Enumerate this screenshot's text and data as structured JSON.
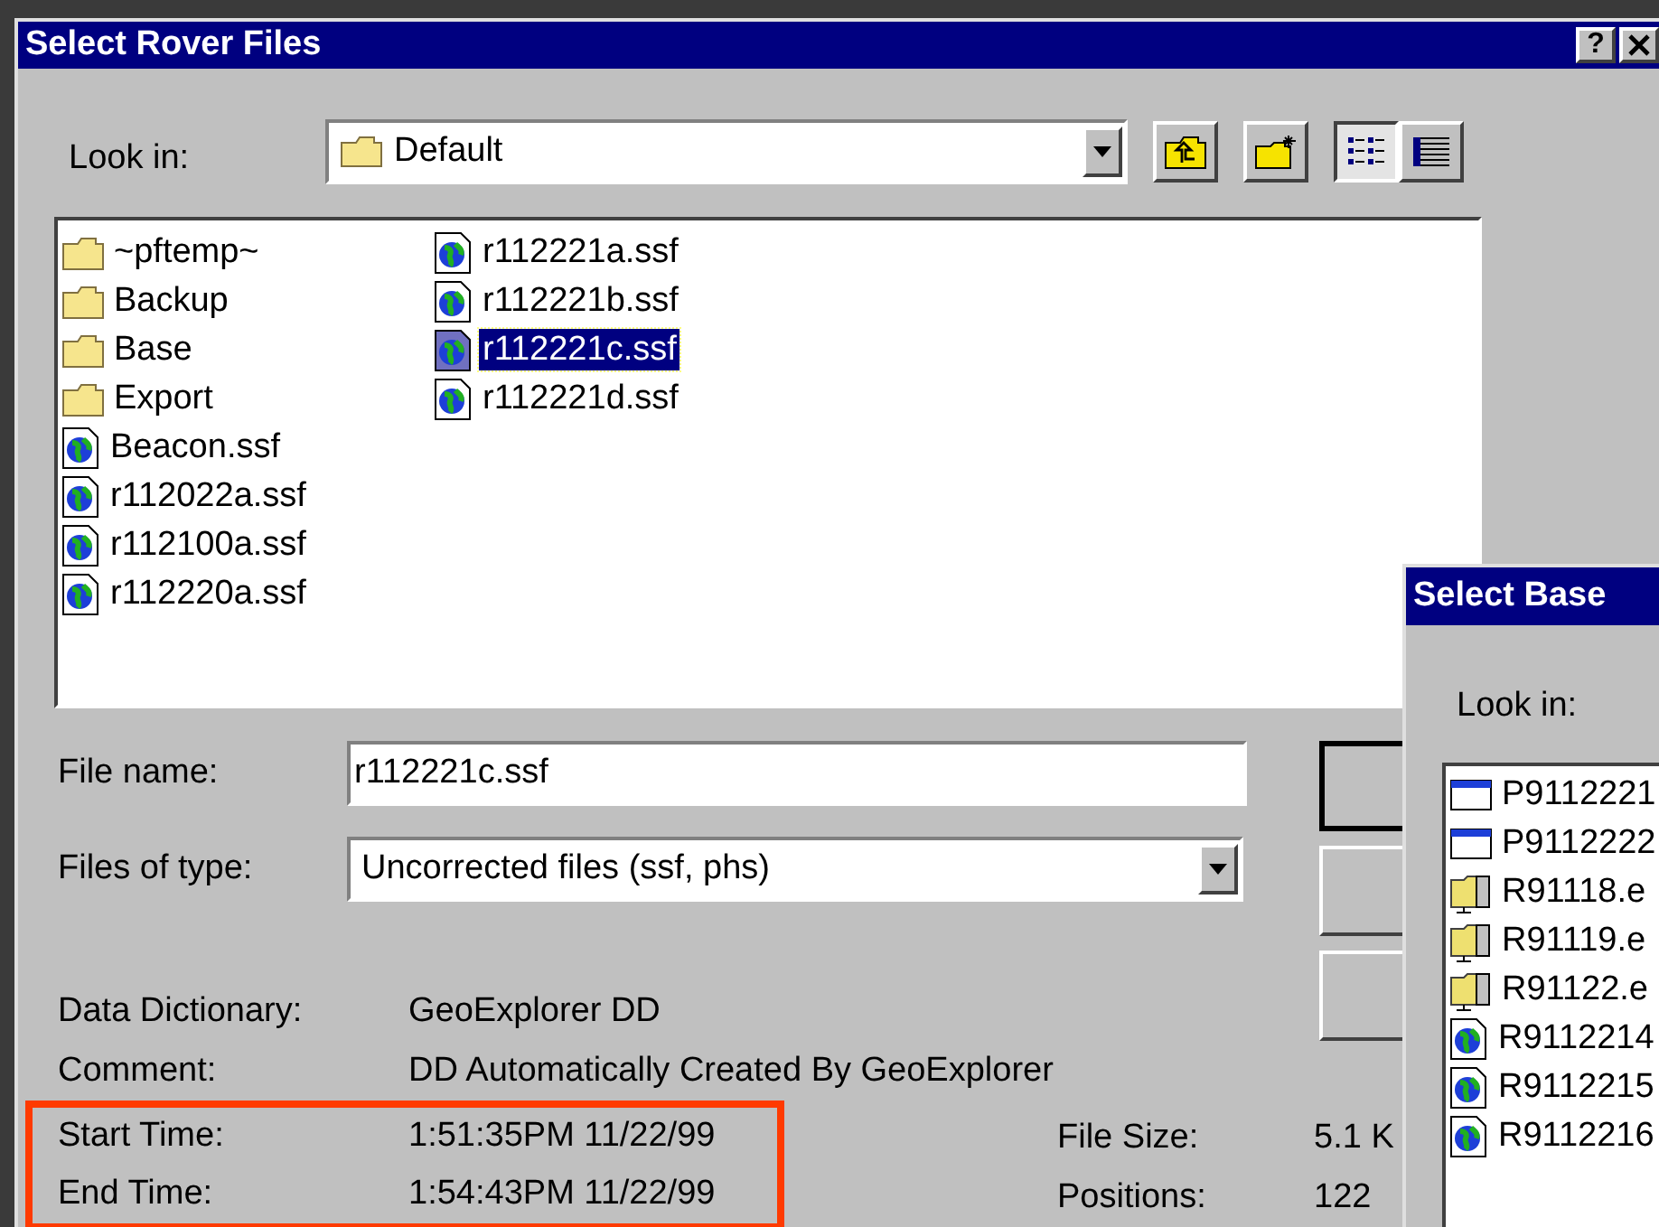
{
  "main_dialog": {
    "title": "Select Rover Files",
    "help_button": "?",
    "look_in": {
      "label": "Look in:",
      "value": "Default"
    },
    "view_buttons": [
      {
        "kind": "list",
        "selected": true
      },
      {
        "kind": "details",
        "selected": false
      }
    ],
    "file_columns": [
      [
        {
          "name": "~pftemp~",
          "kind": "folder",
          "selected": false
        },
        {
          "name": "Backup",
          "kind": "folder",
          "selected": false
        },
        {
          "name": "Base",
          "kind": "folder",
          "selected": false
        },
        {
          "name": "Export",
          "kind": "folder",
          "selected": false
        },
        {
          "name": "Beacon.ssf",
          "kind": "ssf",
          "selected": false
        },
        {
          "name": "r112022a.ssf",
          "kind": "ssf",
          "selected": false
        },
        {
          "name": "r112100a.ssf",
          "kind": "ssf",
          "selected": false
        },
        {
          "name": "r112220a.ssf",
          "kind": "ssf",
          "selected": false
        }
      ],
      [
        {
          "name": "r112221a.ssf",
          "kind": "ssf",
          "selected": false
        },
        {
          "name": "r112221b.ssf",
          "kind": "ssf",
          "selected": false
        },
        {
          "name": "r112221c.ssf",
          "kind": "ssf",
          "selected": true
        },
        {
          "name": "r112221d.ssf",
          "kind": "ssf",
          "selected": false
        }
      ]
    ],
    "file_name": {
      "label": "File name:",
      "value": "r112221c.ssf"
    },
    "file_type": {
      "label": "Files of type:",
      "value": "Uncorrected files (ssf, phs)"
    },
    "info": [
      {
        "label": "Data Dictionary:",
        "value": "GeoExplorer DD"
      },
      {
        "label": "Comment:",
        "value": "DD Automatically Created By GeoExplorer"
      }
    ],
    "times": [
      {
        "label": "Start Time:",
        "value": "1:51:35PM 11/22/99"
      },
      {
        "label": "End Time:",
        "value": "1:54:43PM 11/22/99"
      }
    ],
    "stats": [
      {
        "label": "File Size:",
        "value": "5.1 K"
      },
      {
        "label": "Positions:",
        "value": "122"
      }
    ]
  },
  "base_dialog": {
    "title": "Select Base",
    "look_in_label": "Look in:",
    "files": [
      {
        "name": "P9112221",
        "kind": "window"
      },
      {
        "name": "P9112222",
        "kind": "window"
      },
      {
        "name": "R91118.e",
        "kind": "drive"
      },
      {
        "name": "R91119.e",
        "kind": "drive"
      },
      {
        "name": "R91122.e",
        "kind": "drive"
      },
      {
        "name": "R9112214",
        "kind": "ssf"
      },
      {
        "name": "R9112215",
        "kind": "ssf"
      },
      {
        "name": "R9112216",
        "kind": "ssf"
      }
    ]
  }
}
